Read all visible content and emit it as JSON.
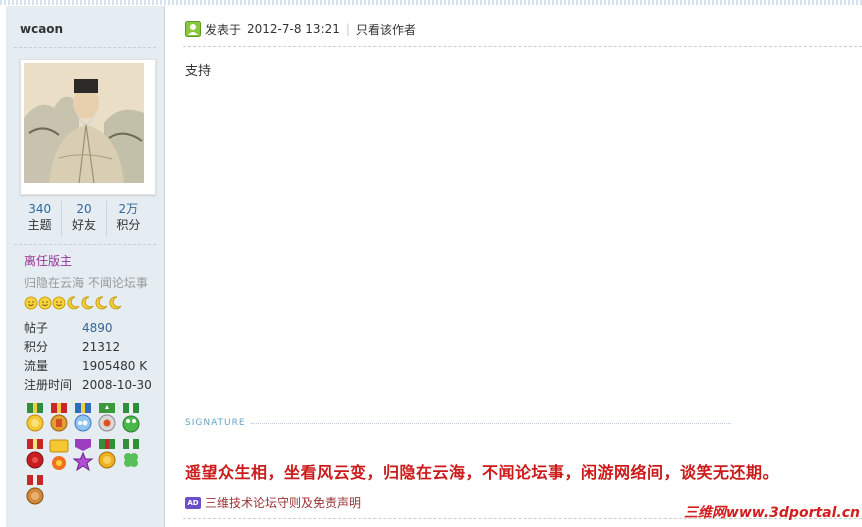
{
  "user": {
    "name": "wcaon",
    "stats": [
      {
        "num": "340",
        "label": "主题"
      },
      {
        "num": "20",
        "label": "好友"
      },
      {
        "num": "2万",
        "label": "积分"
      }
    ],
    "group": "离任版主",
    "sightml": "归隐在云海  不闻论坛事",
    "info": [
      {
        "key": "帖子",
        "value": "4890"
      },
      {
        "key": "积分",
        "value": "21312"
      },
      {
        "key": "流量",
        "value": "1905480 K"
      },
      {
        "key": "注册时间",
        "value": "2008-10-30"
      }
    ]
  },
  "post": {
    "posted_label": "发表于",
    "posted_time": "2012-7-8 13:21",
    "author_only": "只看该作者",
    "content": "支持",
    "signature_label": "SIGNATURE",
    "signature": "遥望众生相，坐看风云变，归隐在云海，不闻论坛事，闲游网络间，谈笑无还期。",
    "ad_badge": "AD",
    "rules_link": "三维技术论坛守则及免责声明"
  },
  "watermark": "三维网www.3dportal.cn",
  "colors": {
    "accent": "#336699",
    "group": "#993399",
    "signature": "#cc1a1a",
    "sidebar_bg": "#e5edf2"
  }
}
